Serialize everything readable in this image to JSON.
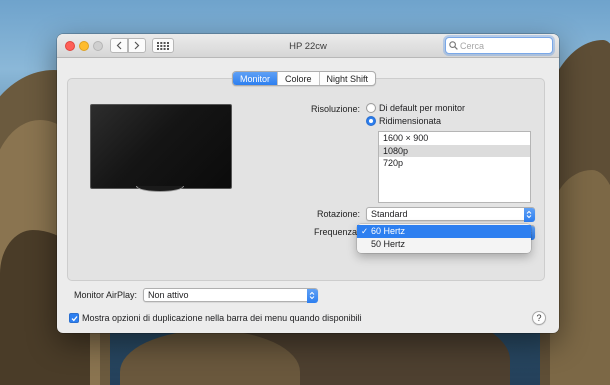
{
  "window": {
    "title": "HP 22cw"
  },
  "search": {
    "placeholder": "Cerca"
  },
  "tabs": [
    {
      "label": "Monitor",
      "active": true
    },
    {
      "label": "Colore",
      "active": false
    },
    {
      "label": "Night Shift",
      "active": false
    }
  ],
  "resolution": {
    "label": "Risoluzione:",
    "options": [
      {
        "label": "Di default per monitor",
        "selected": false
      },
      {
        "label": "Ridimensionata",
        "selected": true
      }
    ],
    "list": [
      {
        "label": "1600 × 900",
        "selected": false
      },
      {
        "label": "1080p",
        "selected": true
      },
      {
        "label": "720p",
        "selected": false
      }
    ]
  },
  "rotation": {
    "label": "Rotazione:",
    "value": "Standard"
  },
  "frequency": {
    "label": "Frequenza",
    "options": [
      {
        "label": "60 Hertz",
        "selected": true
      },
      {
        "label": "50 Hertz",
        "selected": false
      }
    ]
  },
  "airplay": {
    "label": "Monitor AirPlay:",
    "value": "Non attivo"
  },
  "mirroring": {
    "label": "Mostra opzioni di duplicazione nella barra dei menu quando disponibili",
    "checked": true
  },
  "help": {
    "label": "?"
  },
  "colors": {
    "accent": "#2d7ff0",
    "close": "#fe5f57",
    "minimize": "#febc2e"
  }
}
